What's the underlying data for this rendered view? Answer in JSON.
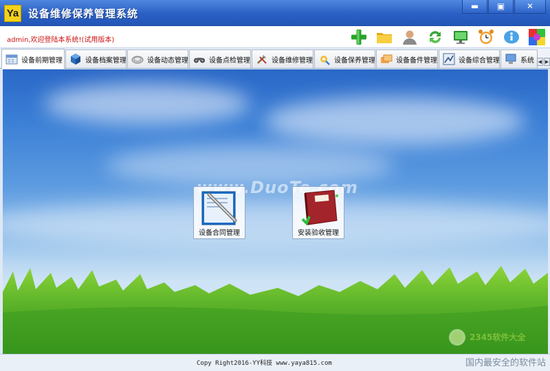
{
  "window": {
    "logo_text": "Ya",
    "title": "设备维修保养管理系统",
    "minimize": "▬",
    "maximize": "▣",
    "close": "✕"
  },
  "toolbar": {
    "welcome": "admin,欢迎登陆本系统!(试用版本)",
    "icons": [
      "add-icon",
      "folder-icon",
      "user-icon",
      "refresh-icon",
      "monitor-icon",
      "alarm-clock-icon",
      "info-icon",
      "color-palette-icon"
    ]
  },
  "tabs": [
    {
      "label": "设备前期管理",
      "icon": "calendar-icon",
      "active": true
    },
    {
      "label": "设备档案管理",
      "icon": "cube-icon",
      "active": false
    },
    {
      "label": "设备动态管理",
      "icon": "disc-icon",
      "active": false
    },
    {
      "label": "设备点检管理",
      "icon": "binoculars-icon",
      "active": false
    },
    {
      "label": "设备维修管理",
      "icon": "tools-icon",
      "active": false
    },
    {
      "label": "设备保养管理",
      "icon": "maintenance-icon",
      "active": false
    },
    {
      "label": "设备备件管理",
      "icon": "parts-icon",
      "active": false
    },
    {
      "label": "设备综合管理",
      "icon": "chart-icon",
      "active": false
    },
    {
      "label": "系统",
      "icon": "system-icon",
      "active": false
    }
  ],
  "main": {
    "watermark": "www.DuoTe.com",
    "tiles": [
      {
        "label": "设备合同管理",
        "icon": "contract-book-icon"
      },
      {
        "label": "安装验收管理",
        "icon": "acceptance-book-icon"
      }
    ],
    "corner_logo": "2345软件大全"
  },
  "status": {
    "copyright": "Copy Right2016-YY科技  www.yaya815.com",
    "corner_caption": "国内最安全的软件站"
  }
}
